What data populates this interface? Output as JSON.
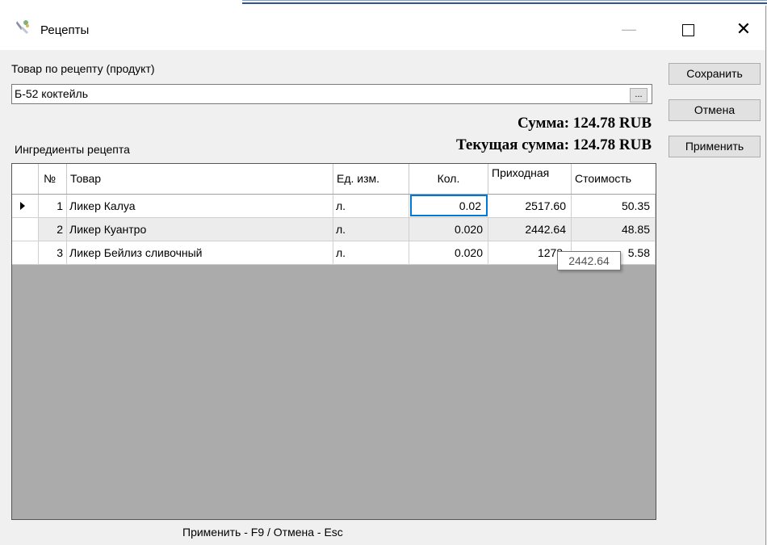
{
  "window": {
    "title": "Рецепты",
    "icon": "recipe-app-icon"
  },
  "form": {
    "product_label": "Товар по рецепту (продукт)",
    "product_value": "Б-52 коктейль",
    "browse_label": "...",
    "ingredients_label": "Ингредиенты рецепта"
  },
  "summary": {
    "sum": "Сумма: 124.78 RUB",
    "current_sum": "Текущая сумма: 124.78 RUB"
  },
  "actions": {
    "save": "Сохранить",
    "cancel": "Отмена",
    "apply": "Применить"
  },
  "grid": {
    "columns": [
      "№",
      "Товар",
      "Ед. изм.",
      "Кол.",
      "Приходная",
      "Стоимость"
    ],
    "rows": [
      {
        "num": "1",
        "name": "Ликер Калуа",
        "unit": "л.",
        "qty": "0.02",
        "price": "2517.60",
        "cost": "50.35"
      },
      {
        "num": "2",
        "name": "Ликер Куантро",
        "unit": "л.",
        "qty": "0.020",
        "price": "2442.64",
        "cost": "48.85"
      },
      {
        "num": "3",
        "name": "Ликер Бейлиз сливочный",
        "unit": "л.",
        "qty": "0.020",
        "price": "1278.",
        "cost": "5.58"
      }
    ]
  },
  "tooltip": "2442.64",
  "footer": "Применить - F9 / Отмена - Esc",
  "colors": {
    "grid_empty": "#ababab",
    "row_alt": "#ececec",
    "selection_border": "#0078d7"
  }
}
